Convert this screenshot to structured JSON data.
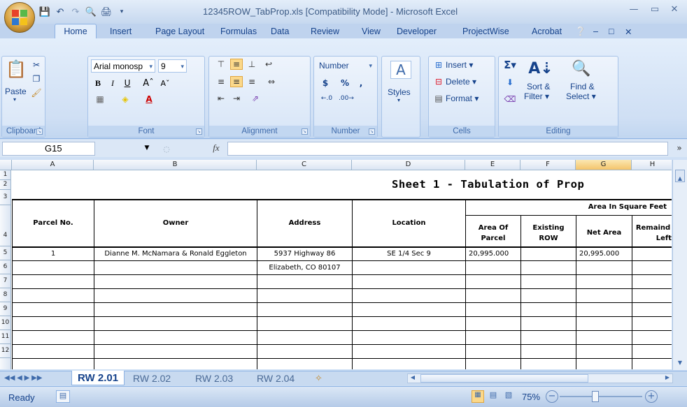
{
  "window": {
    "title": "12345ROW_TabProp.xls  [Compatibility Mode] - Microsoft Excel"
  },
  "ribbon_tabs": [
    "Home",
    "Insert",
    "Page Layout",
    "Formulas",
    "Data",
    "Review",
    "View",
    "Developer",
    "ProjectWise",
    "Acrobat"
  ],
  "clipboard": {
    "paste": "Paste",
    "label": "Clipboard"
  },
  "font": {
    "name": "Arial monosp",
    "size": "9",
    "label": "Font"
  },
  "alignment": {
    "label": "Alignment"
  },
  "number": {
    "format": "Number",
    "currency": "$",
    "percent": "%",
    "comma": ",",
    "label": "Number"
  },
  "styles": {
    "label": "Styles"
  },
  "cells": {
    "insert": "Insert",
    "delete": "Delete",
    "format": "Format",
    "label": "Cells"
  },
  "editing": {
    "sort": "Sort &",
    "filter": "Filter",
    "find": "Find &",
    "select": "Select",
    "label": "Editing"
  },
  "formula_bar": {
    "name_box": "G15",
    "fx": "fx"
  },
  "columns": [
    "A",
    "B",
    "C",
    "D",
    "E",
    "F",
    "G",
    "H"
  ],
  "rows": [
    "1",
    "2",
    "3",
    "4",
    "5",
    "6",
    "7",
    "8",
    "9",
    "10",
    "11",
    "12"
  ],
  "sheet": {
    "title": "Sheet 1 - Tabulation of Prop",
    "area_header": "Area In Square Feet",
    "headers": {
      "parcel": "Parcel No.",
      "owner": "Owner",
      "address": "Address",
      "location": "Location",
      "area_of": "Area Of",
      "parcel2": "Parcel",
      "existing": "Existing",
      "row": "ROW",
      "net_area": "Net Area",
      "remaind": "Remaind",
      "left": "Left"
    },
    "data": {
      "parcel_no": "1",
      "owner": "Dianne M. McNamara & Ronald Eggleton",
      "address1": "5937 Highway 86",
      "address2": "Elizabeth, CO 80107",
      "location": "SE 1/4 Sec 9",
      "area": "20,995.000",
      "net_area": "20,995.000"
    }
  },
  "sheet_tabs": [
    "RW 2.01",
    "RW 2.02",
    "RW 2.03",
    "RW 2.04"
  ],
  "status": {
    "ready": "Ready",
    "zoom": "75%"
  }
}
